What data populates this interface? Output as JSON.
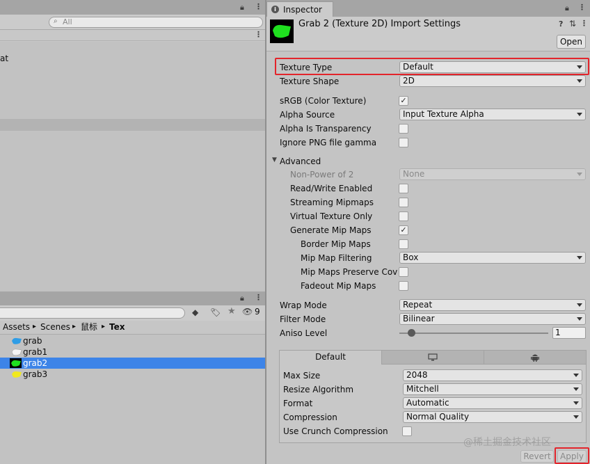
{
  "hierarchy": {
    "search_placeholder": "All",
    "partial_text": "at"
  },
  "project": {
    "breadcrumb": [
      "Assets",
      "Scenes",
      "鼠标",
      "Tex"
    ],
    "hidden_count": "9",
    "items": [
      {
        "label": "grab",
        "color": "#2f9de6"
      },
      {
        "label": "grab1",
        "color": "#f4f4f4"
      },
      {
        "label": "grab2",
        "color": "#1fe01f"
      },
      {
        "label": "grab3",
        "color": "#f0e81e"
      }
    ],
    "selected_color": "#3d84e8"
  },
  "inspector": {
    "tab_label": "Inspector",
    "title": "Grab 2 (Texture 2D) Import Settings",
    "open_label": "Open",
    "texture_type": {
      "label": "Texture Type",
      "value": "Default"
    },
    "texture_shape": {
      "label": "Texture Shape",
      "value": "2D"
    },
    "srgb": {
      "label": "sRGB (Color Texture)",
      "checked": true
    },
    "alpha_source": {
      "label": "Alpha Source",
      "value": "Input Texture Alpha"
    },
    "alpha_transparency": {
      "label": "Alpha Is Transparency",
      "checked": false
    },
    "ignore_png": {
      "label": "Ignore PNG file gamma",
      "checked": false
    },
    "advanced": {
      "label": "Advanced",
      "non_power": {
        "label": "Non-Power of 2",
        "value": "None"
      },
      "read_write": {
        "label": "Read/Write Enabled",
        "checked": false
      },
      "streaming": {
        "label": "Streaming Mipmaps",
        "checked": false
      },
      "virtual_texture": {
        "label": "Virtual Texture Only",
        "checked": false
      },
      "generate_mip": {
        "label": "Generate Mip Maps",
        "checked": true
      },
      "border_mip": {
        "label": "Border Mip Maps",
        "checked": false
      },
      "mip_filtering": {
        "label": "Mip Map Filtering",
        "value": "Box"
      },
      "preserve_cov": {
        "label": "Mip Maps Preserve Cov",
        "checked": false
      },
      "fadeout": {
        "label": "Fadeout Mip Maps",
        "checked": false
      }
    },
    "wrap_mode": {
      "label": "Wrap Mode",
      "value": "Repeat"
    },
    "filter_mode": {
      "label": "Filter Mode",
      "value": "Bilinear"
    },
    "aniso": {
      "label": "Aniso Level",
      "value": "1",
      "slider_fraction": 0.0
    },
    "platform_tabs": {
      "default_label": "Default",
      "icons": [
        "monitor-icon",
        "android-icon"
      ]
    },
    "platform": {
      "max_size": {
        "label": "Max Size",
        "value": "2048"
      },
      "resize": {
        "label": "Resize Algorithm",
        "value": "Mitchell"
      },
      "format": {
        "label": "Format",
        "value": "Automatic"
      },
      "compression": {
        "label": "Compression",
        "value": "Normal Quality"
      },
      "crunch": {
        "label": "Use Crunch Compression",
        "checked": false
      }
    },
    "revert_label": "Revert",
    "apply_label": "Apply",
    "watermark": "@稀土掘金技术社区",
    "highlight_color": "#e3242b"
  }
}
